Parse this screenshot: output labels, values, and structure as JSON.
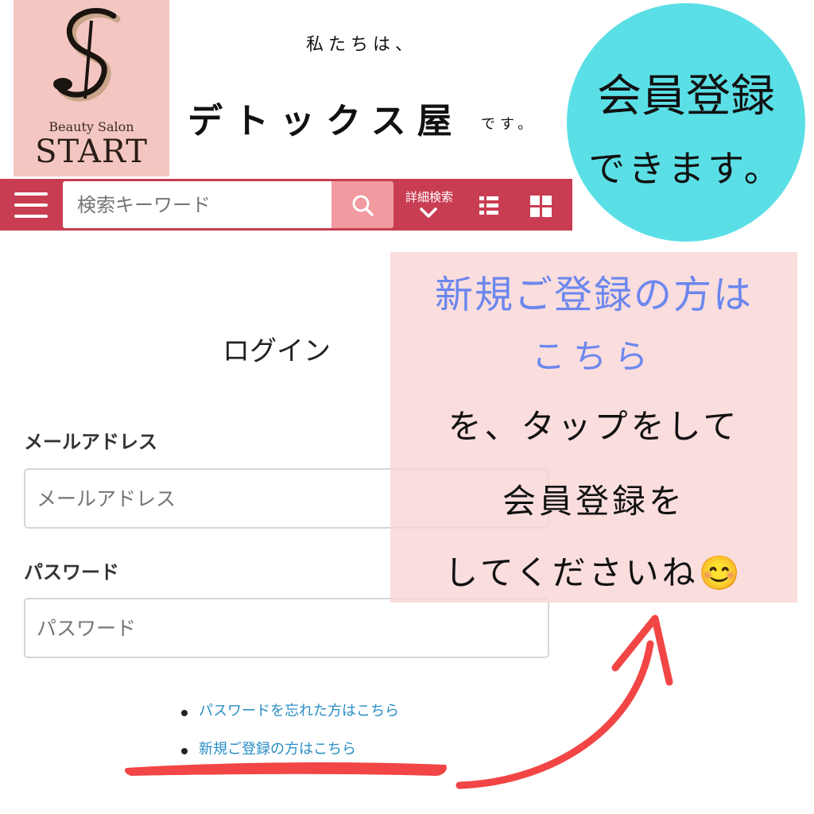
{
  "logo": {
    "subtitle": "Beauty Salon",
    "name": "START"
  },
  "tagline": {
    "line1": "私たちは、",
    "line2": "デトックス屋",
    "line3": "です。"
  },
  "badge": {
    "line1": "会員登録",
    "line2": "できます。",
    "color": "#5bdfe6"
  },
  "toolbar": {
    "bg_color": "#c93d52",
    "search_placeholder": "検索キーワード",
    "advanced_search_label": "詳細検索"
  },
  "login": {
    "title": "ログイン",
    "email_label": "メールアドレス",
    "email_placeholder": "メールアドレス",
    "password_label": "パスワード",
    "password_placeholder": "パスワード",
    "links": [
      {
        "label": "パスワードを忘れた方はこちら"
      },
      {
        "label": "新規ご登録の方はこちら"
      }
    ]
  },
  "note": {
    "highlight_line1": "新規ご登録の方は",
    "highlight_line2": "こちら",
    "line3": "を、タップをして",
    "line4": "会員登録を",
    "line5": "してくださいね😊",
    "highlight_color": "#6b87ee"
  },
  "icons": [
    "menu-icon",
    "search-icon",
    "chevron-down-icon",
    "list-view-icon",
    "grid-view-icon"
  ]
}
